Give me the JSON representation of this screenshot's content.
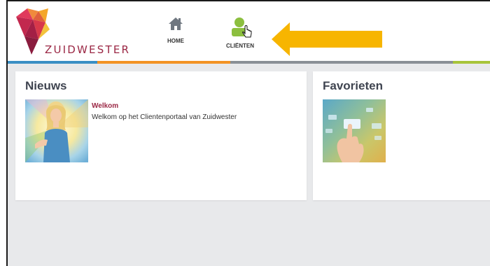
{
  "brand": {
    "name": "ZUIDWESTER",
    "logo_icon": "zuidwester-diamond-logo"
  },
  "nav": [
    {
      "label": "HOME",
      "icon": "home-icon"
    },
    {
      "label": "CLIËNTEN",
      "icon": "client-person-icon"
    }
  ],
  "colors": {
    "brand_red": "#9b2845",
    "stripe_blue": "#3a8fc4",
    "stripe_orange": "#f39325",
    "stripe_gray": "#8a9096",
    "stripe_green": "#a8c43a",
    "arrow_yellow": "#f7b500",
    "background": "#e8e9eb"
  },
  "news": {
    "title": "Nieuws",
    "item": {
      "heading": "Welkom",
      "text": "Welkom op het Clientenportaal van Zuidwester"
    }
  },
  "favorites": {
    "title": "Favorieten"
  }
}
